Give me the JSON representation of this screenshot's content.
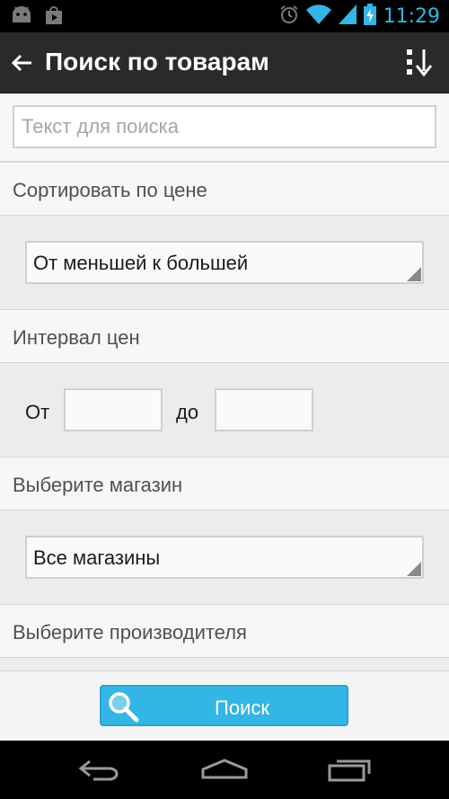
{
  "status_bar": {
    "time": "11:29",
    "left_icons": [
      "android-debug-icon",
      "play-store-icon"
    ],
    "right_icons": [
      "alarm-icon",
      "wifi-icon",
      "signal-icon",
      "battery-charging-icon"
    ]
  },
  "action_bar": {
    "title": "Поиск по товарам",
    "back_icon": "back-arrow-icon",
    "action_icon": "sort-icon"
  },
  "search": {
    "placeholder": "Текст для поиска",
    "value": ""
  },
  "sort": {
    "label": "Сортировать по цене",
    "selected": "От меньшей к большей"
  },
  "price_range": {
    "label": "Интервал цен",
    "from_label": "От",
    "to_label": "до",
    "from_value": "",
    "to_value": ""
  },
  "store": {
    "label": "Выберите магазин",
    "selected": "Все магазины"
  },
  "manufacturer": {
    "label": "Выберите производителя"
  },
  "search_button": {
    "label": "Поиск",
    "icon": "magnifier-icon"
  },
  "nav_bar": {
    "buttons": [
      "back-icon",
      "home-icon",
      "recents-icon"
    ]
  },
  "colors": {
    "accent": "#33b5e5",
    "action_bar": "#2a2a2a",
    "status_bar": "#000000"
  }
}
